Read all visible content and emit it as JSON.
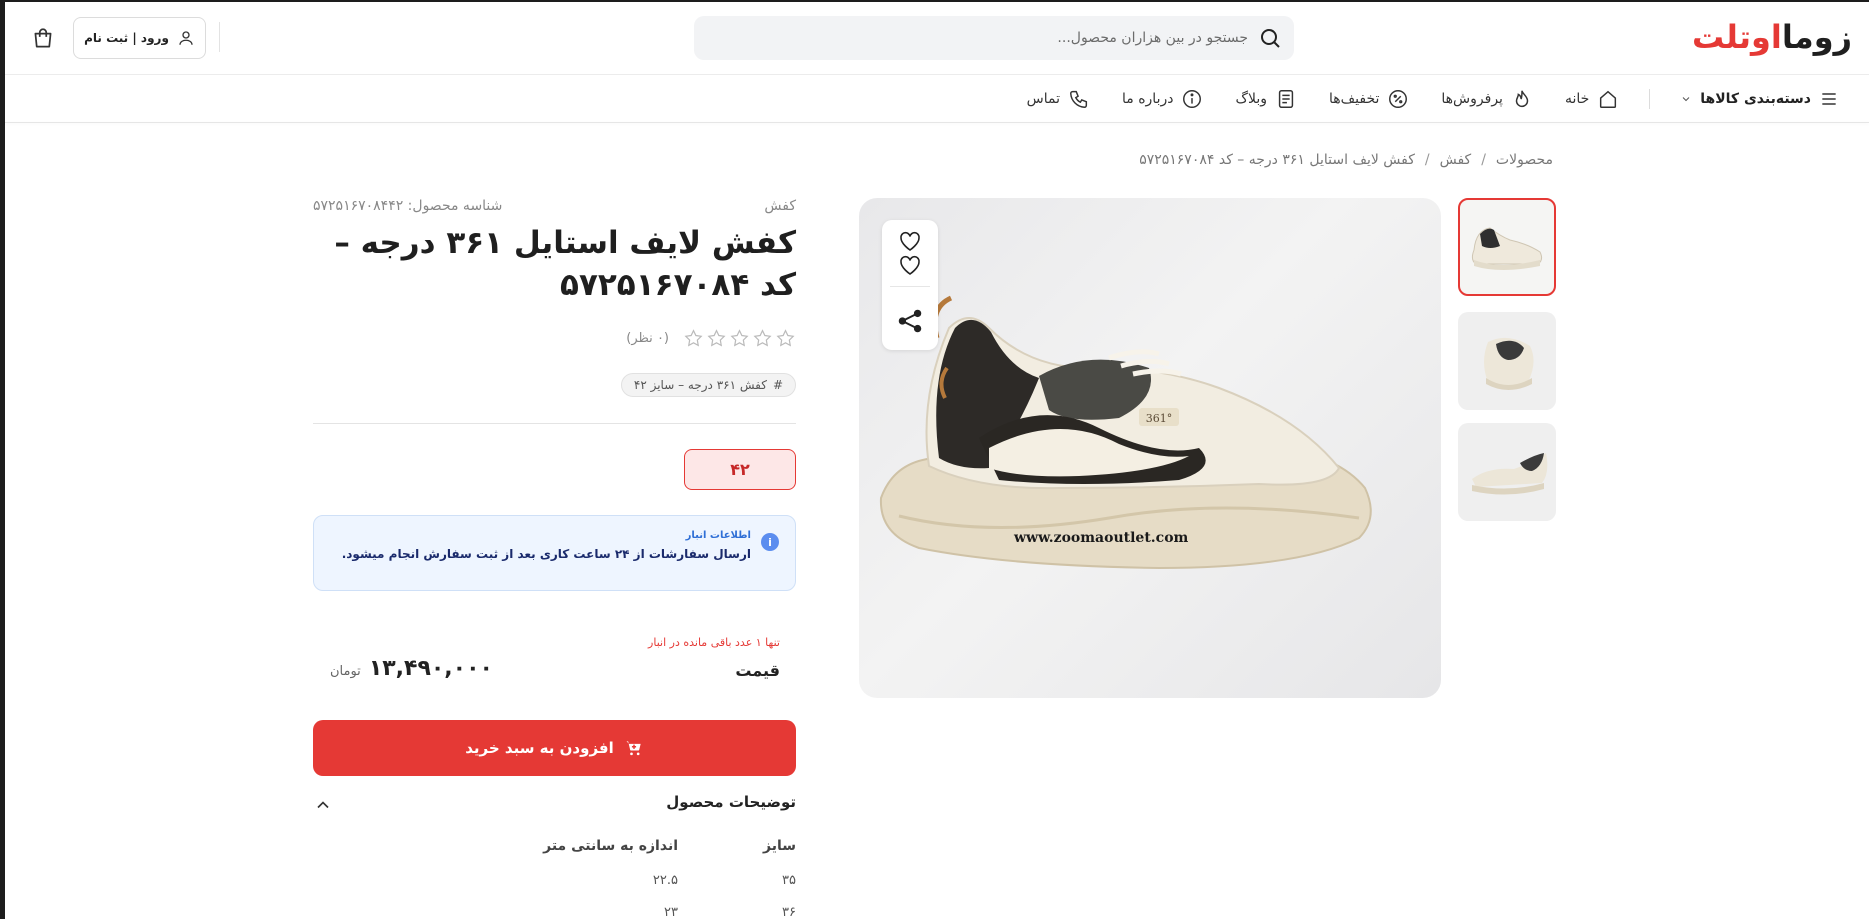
{
  "header": {
    "logo_part1": "زوما",
    "logo_part2": "اوتلت",
    "search_placeholder": "جستجو در بین هزاران محصول...",
    "login_label": "ورود | ثبت نام"
  },
  "nav": {
    "categories_label": "دسته‌بندی کالاها",
    "items": [
      {
        "label": "خانه",
        "icon": "home-icon"
      },
      {
        "label": "پرفروش‌ها",
        "icon": "fire-icon"
      },
      {
        "label": "تخفیف‌ها",
        "icon": "discount-icon"
      },
      {
        "label": "وبلاگ",
        "icon": "document-icon"
      },
      {
        "label": "درباره ما",
        "icon": "info-icon"
      },
      {
        "label": "تماس",
        "icon": "phone-icon"
      }
    ]
  },
  "breadcrumb": {
    "items": [
      "محصولات",
      "کفش",
      "کفش لایف استایل ۳۶۱ درجه – کد ۵۷۲۵۱۶۷۰۸۴"
    ],
    "separator": "/"
  },
  "product": {
    "category": "کفش",
    "sku": "شناسه محصول: ۵۷۲۵۱۶۷۰۸۴۴۲",
    "title": "کفش لایف استایل ۳۶۱ درجه – کد ۵۷۲۵۱۶۷۰۸۴",
    "rating_count": "(۰ نظر)",
    "rating_value": 0,
    "rating_max": 5,
    "tag": "کفش ۳۶۱ درجه – سایز ۴۲",
    "tag_hash": "#",
    "size": "۴۲",
    "stock_title": "اطلاعات انبار",
    "stock_text": "ارسال سفارشات از ۲۴ ساعت کاری بعد از ثبت سفارش انجام میشود.",
    "remaining": "تنها ۱ عدد باقی مانده در انبار",
    "price_label": "قیمت",
    "price": "۱۳,۴۹۰,۰۰۰",
    "currency": "تومان",
    "add_to_cart": "افزودن به سبد خرید",
    "watermark": "www.zoomaoutlet.com",
    "brand_mark": "361°"
  },
  "description": {
    "title": "توضیحات محصول",
    "columns": [
      "سایز",
      "اندازه به سانتی متر"
    ],
    "rows": [
      [
        "۳۵",
        "۲۲.۵"
      ],
      [
        "۳۶",
        "۲۳"
      ]
    ]
  },
  "colors": {
    "accent": "#e53935",
    "info_bg": "#eef5ff",
    "info_text": "#1a2a6c"
  }
}
